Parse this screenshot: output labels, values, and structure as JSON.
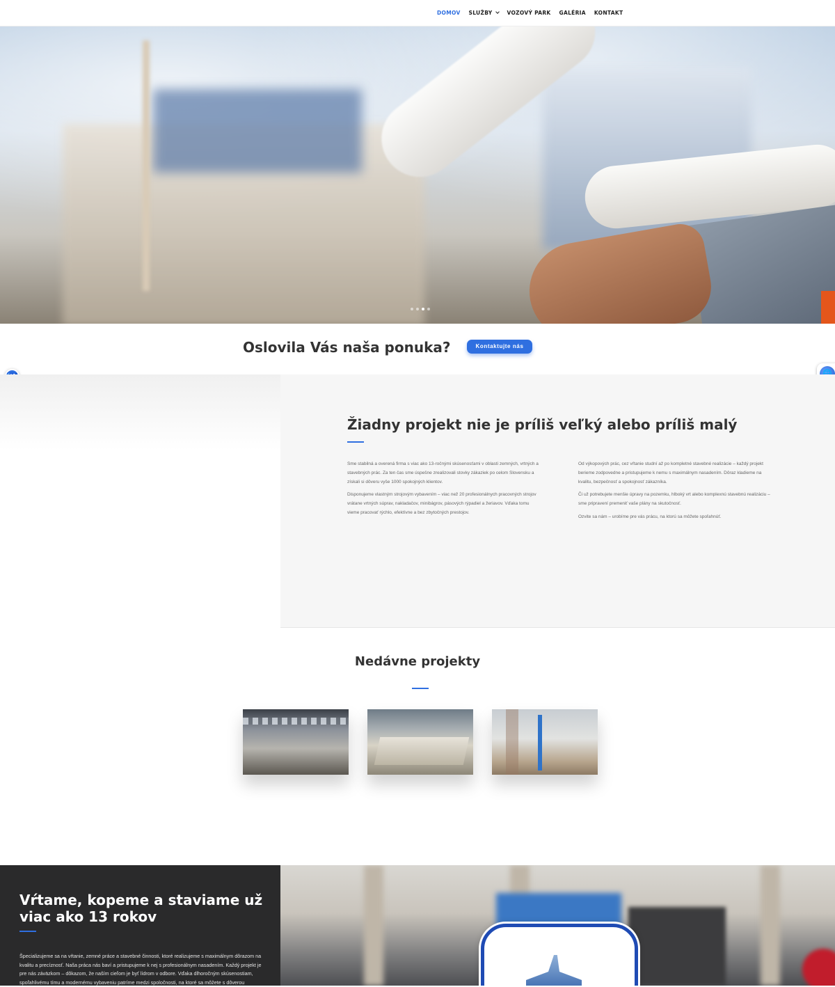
{
  "nav": {
    "items": [
      {
        "label": "DOMOV",
        "active": true
      },
      {
        "label": "SLUŽBY",
        "has_dropdown": true
      },
      {
        "label": "VOZOVÝ PARK"
      },
      {
        "label": "GALÉRIA"
      },
      {
        "label": "KONTAKT"
      }
    ]
  },
  "hero": {
    "slide_count": 4,
    "active_slide": 3
  },
  "cta": {
    "heading": "Oslovila Vás naša ponuka?",
    "button_label": "Kontaktujte nás"
  },
  "about": {
    "heading": "Žiadny projekt nie je príliš veľký alebo príliš malý",
    "col1": [
      "Sme stabilná a overená firma s viac ako 13-ročnými skúsenosťami v oblasti zemných, vrtných a stavebných prác. Za ten čas sme úspešne zrealizovali stovky zákaziek po celom Slovensku a získali si dôveru vyše 1000 spokojných klientov.",
      "Disponujeme vlastným strojovým vybavením – viac než 20 profesionálnych pracovných strojov vrátane vrtných súprav, nakladačov, minibágrov, pásových rýpadiel a žeriavov. Vďaka tomu vieme pracovať rýchlo, efektívne a bez zbytočných prestojov."
    ],
    "col2": [
      "Od výkopových prác, cez vŕtanie studní až po kompletné stavebné realizácie – každý projekt berieme zodpovedne a pristupujeme k nemu s maximálnym nasadením. Dôraz kladieme na kvalitu, bezpečnosť a spokojnosť zákazníka.",
      "Či už potrebujete menšie úpravy na pozemku, hlboký vrt alebo komplexnú stavebnú realizáciu – sme pripravení premeniť vaše plány na skutočnosť.",
      "Ozvite sa nám – urobíme pre vás prácu, na ktorú sa môžete spoľahnúť."
    ]
  },
  "projects": {
    "heading": "Nedávne projekty"
  },
  "bottom": {
    "heading": "Vŕtame, kopeme a staviame už viac ako 13 rokov",
    "text": "Špecializujeme sa na vŕtanie, zemné práce a stavebné činnosti, ktoré realizujeme s maximálnym dôrazom na kvalitu a precíznosť. Naša práca nás baví a pristupujeme k nej s profesionálnym nasadením. Každý projekt je pre nás záväzkom – dôkazom, že naším cieľom je byť lídrom v odbore. Vďaka dlhoročným skúsenostiam, spoľahlivému tímu a modernému vybaveniu patríme medzi spoločnosti, na ktoré sa môžete s dôverou"
  },
  "icons": {
    "accessibility_left": "accessibility-icon",
    "accessibility_right": "translate-globe-icon"
  },
  "colors": {
    "accent": "#2f6fe0",
    "dark": "#2a2a2b"
  }
}
